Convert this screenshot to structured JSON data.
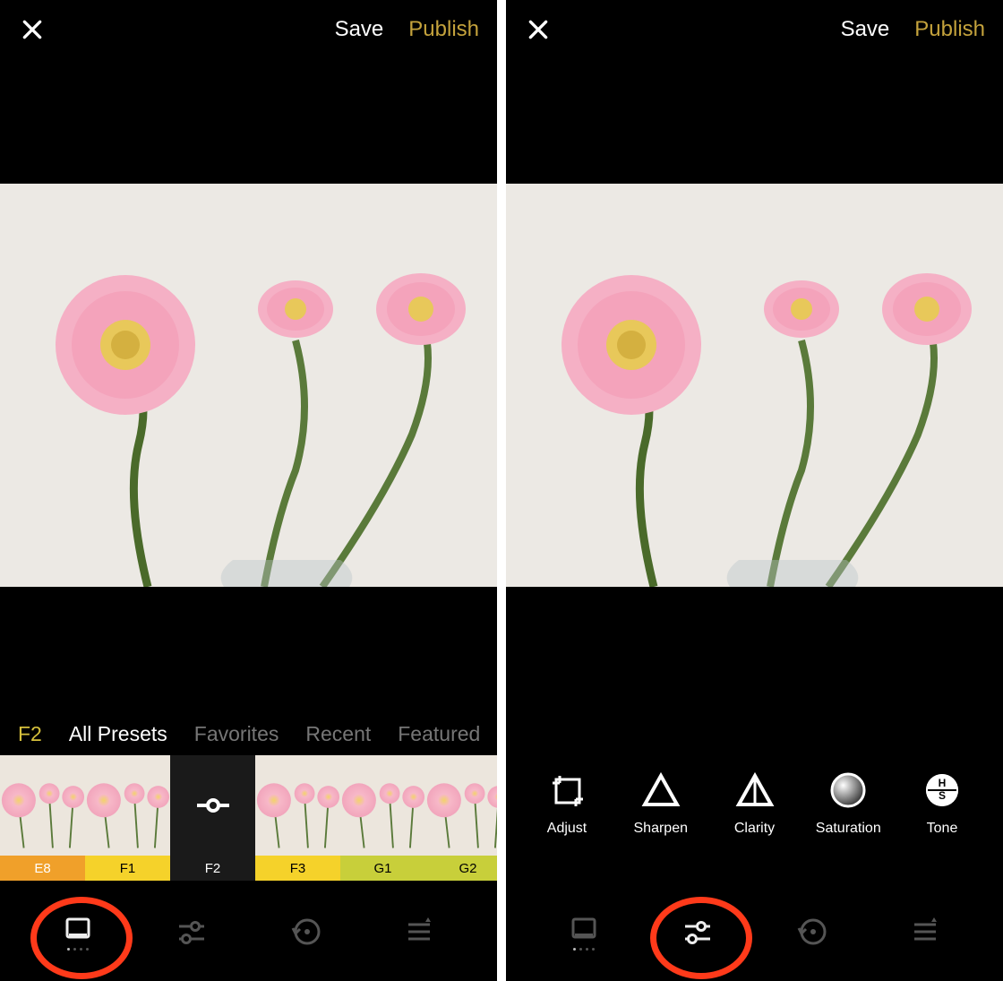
{
  "colors": {
    "accent_yellow": "#d6c03c",
    "publish_gold": "#c4a23c",
    "annotation_red": "#ff3a1a",
    "preset_colors": {
      "E8": "#f0a02a",
      "F1": "#f5d22a",
      "F2": "#1a1a1a",
      "F3": "#f5d22a",
      "G1": "#c8cf3a",
      "G2": "#c8cf3a"
    }
  },
  "left": {
    "header": {
      "save": "Save",
      "publish": "Publish"
    },
    "preset_tabs": [
      {
        "label": "F2",
        "kind": "active"
      },
      {
        "label": "All Presets",
        "kind": "white"
      },
      {
        "label": "Favorites",
        "kind": "gray"
      },
      {
        "label": "Recent",
        "kind": "gray"
      },
      {
        "label": "Featured",
        "kind": "gray"
      }
    ],
    "presets": [
      {
        "label": "E8",
        "selected": false
      },
      {
        "label": "F1",
        "selected": false
      },
      {
        "label": "F2",
        "selected": true
      },
      {
        "label": "F3",
        "selected": false
      },
      {
        "label": "G1",
        "selected": false
      },
      {
        "label": "G2",
        "selected": false
      }
    ],
    "bottom_bar": {
      "items": [
        "presets",
        "sliders",
        "history",
        "options"
      ],
      "selected": "presets"
    }
  },
  "right": {
    "header": {
      "save": "Save",
      "publish": "Publish"
    },
    "tools": [
      {
        "label": "Adjust",
        "icon": "crop-icon"
      },
      {
        "label": "Sharpen",
        "icon": "triangle-icon"
      },
      {
        "label": "Clarity",
        "icon": "triangle-split-icon"
      },
      {
        "label": "Saturation",
        "icon": "circle-gradient-icon"
      },
      {
        "label": "Tone",
        "icon": "hs-icon"
      }
    ],
    "bottom_bar": {
      "items": [
        "presets",
        "sliders",
        "history",
        "options"
      ],
      "selected": "sliders"
    }
  }
}
